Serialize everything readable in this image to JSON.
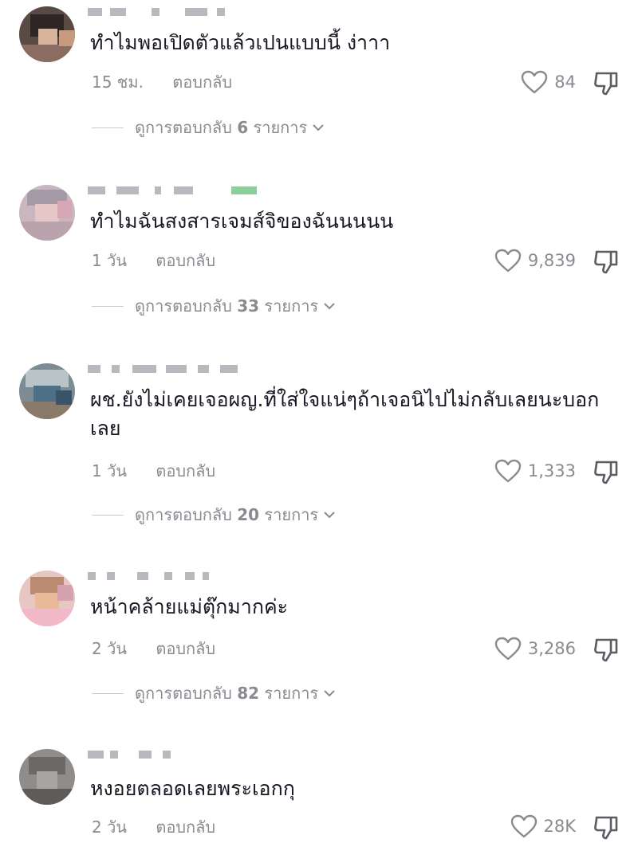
{
  "comments": [
    {
      "text": "ทำไมพอเปิดตัวแล้วเปนแบบนี้ ง่าาา",
      "time": "15 ชม.",
      "reply_label": "ตอบกลับ",
      "likes": "84",
      "view_replies_prefix": "ดูการตอบกลับ",
      "reply_count": "6",
      "view_replies_suffix": "รายการ"
    },
    {
      "text": "ทำไมฉันสงสารเจมส์จิของฉันนนนน",
      "time": "1 วัน",
      "reply_label": "ตอบกลับ",
      "likes": "9,839",
      "view_replies_prefix": "ดูการตอบกลับ",
      "reply_count": "33",
      "view_replies_suffix": "รายการ"
    },
    {
      "text": "ผช.ยังไม่เคยเจอผญ.ที่ใส่ใจแน่ๆถ้าเจอนิไปไม่กลับเลยนะบอกเลย",
      "time": "1 วัน",
      "reply_label": "ตอบกลับ",
      "likes": "1,333",
      "view_replies_prefix": "ดูการตอบกลับ",
      "reply_count": "20",
      "view_replies_suffix": "รายการ"
    },
    {
      "text": "หน้าคล้ายแม่ตุ๊กมากค่ะ",
      "time": "2 วัน",
      "reply_label": "ตอบกลับ",
      "likes": "3,286",
      "view_replies_prefix": "ดูการตอบกลับ",
      "reply_count": "82",
      "view_replies_suffix": "รายการ"
    },
    {
      "text": "หงอยตลอดเลยพระเอกกุ",
      "time": "2 วัน",
      "reply_label": "ตอบกลับ",
      "likes": "28K"
    }
  ],
  "icons": {
    "like": "heart-outline-icon",
    "dislike": "thumbs-down-icon",
    "chevron": "chevron-down-icon"
  },
  "colors": {
    "text": "#161823",
    "secondary": "#8a8b91",
    "background": "#ffffff"
  }
}
